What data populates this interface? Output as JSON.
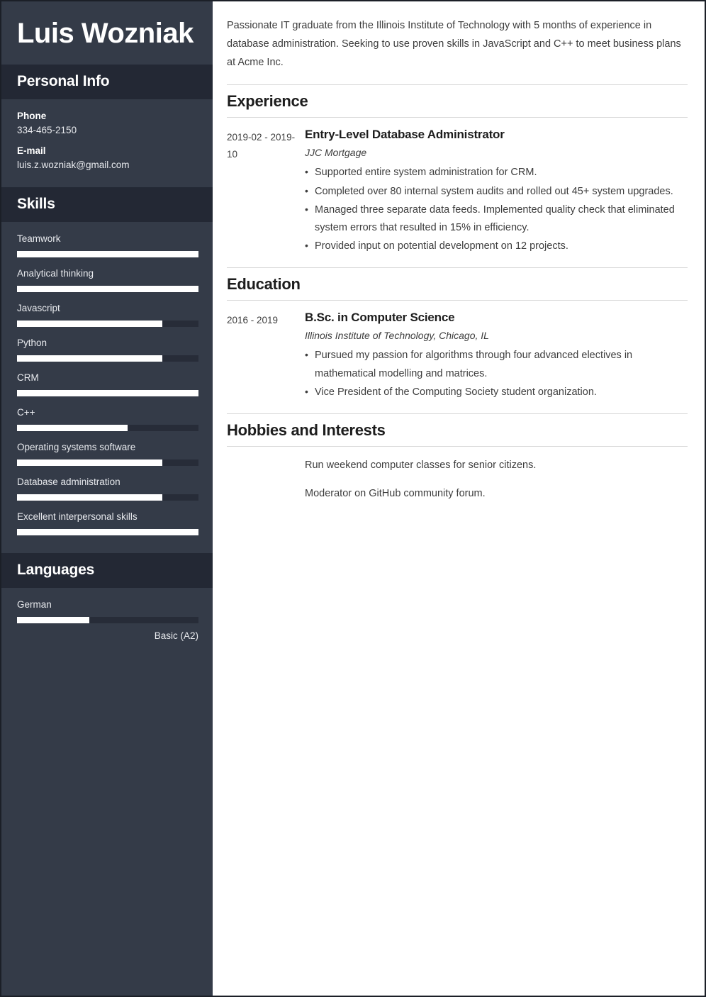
{
  "sidebar": {
    "full_name": "Luis Wozniak",
    "personal_info": {
      "title": "Personal Info",
      "items": [
        {
          "label": "Phone",
          "value": "334-465-2150"
        },
        {
          "label": "E-mail",
          "value": "luis.z.wozniak@gmail.com"
        }
      ]
    },
    "skills": {
      "title": "Skills",
      "items": [
        {
          "name": "Teamwork",
          "level": 100
        },
        {
          "name": "Analytical thinking",
          "level": 100
        },
        {
          "name": "Javascript",
          "level": 80
        },
        {
          "name": "Python",
          "level": 80
        },
        {
          "name": "CRM",
          "level": 100
        },
        {
          "name": "C++",
          "level": 61
        },
        {
          "name": "Operating systems software",
          "level": 80
        },
        {
          "name": "Database administration",
          "level": 80
        },
        {
          "name": "Excellent interpersonal skills",
          "level": 100
        }
      ]
    },
    "languages": {
      "title": "Languages",
      "items": [
        {
          "name": "German",
          "level": 40,
          "level_label": "Basic (A2)"
        }
      ]
    }
  },
  "main": {
    "summary": "Passionate IT graduate from the Illinois Institute of Technology with 5 months of experience in database administration. Seeking to use proven skills in JavaScript and C++ to meet business plans at Acme Inc.",
    "experience": {
      "title": "Experience",
      "entries": [
        {
          "dates": "2019-02 - 2019-10",
          "title": "Entry-Level Database Administrator",
          "subtitle": "JJC Mortgage",
          "bullets": [
            "Supported entire system administration for CRM.",
            "Completed over 80 internal system audits and rolled out 45+ system upgrades.",
            "Managed three separate data feeds. Implemented quality check that eliminated system errors that resulted in 15% in efficiency.",
            "Provided input on potential development on 12 projects."
          ]
        }
      ]
    },
    "education": {
      "title": "Education",
      "entries": [
        {
          "dates": "2016 - 2019",
          "title": "B.Sc. in Computer Science",
          "subtitle": "Illinois Institute of Technology, Chicago, IL",
          "bullets": [
            "Pursued my passion for algorithms through four advanced electives in mathematical modelling and matrices.",
            "Vice President of the Computing Society student organization."
          ]
        }
      ]
    },
    "hobbies": {
      "title": "Hobbies and Interests",
      "items": [
        "Run weekend computer classes for senior citizens.",
        "Moderator on GitHub community forum."
      ]
    }
  },
  "colors": {
    "sidebar_bg": "#343b48",
    "sidebar_header_bg": "#232834",
    "bar_track": "#272c38",
    "bar_fill": "#ffffff",
    "page_bg": "#ffffff",
    "text_dark": "#3d3d3d"
  }
}
